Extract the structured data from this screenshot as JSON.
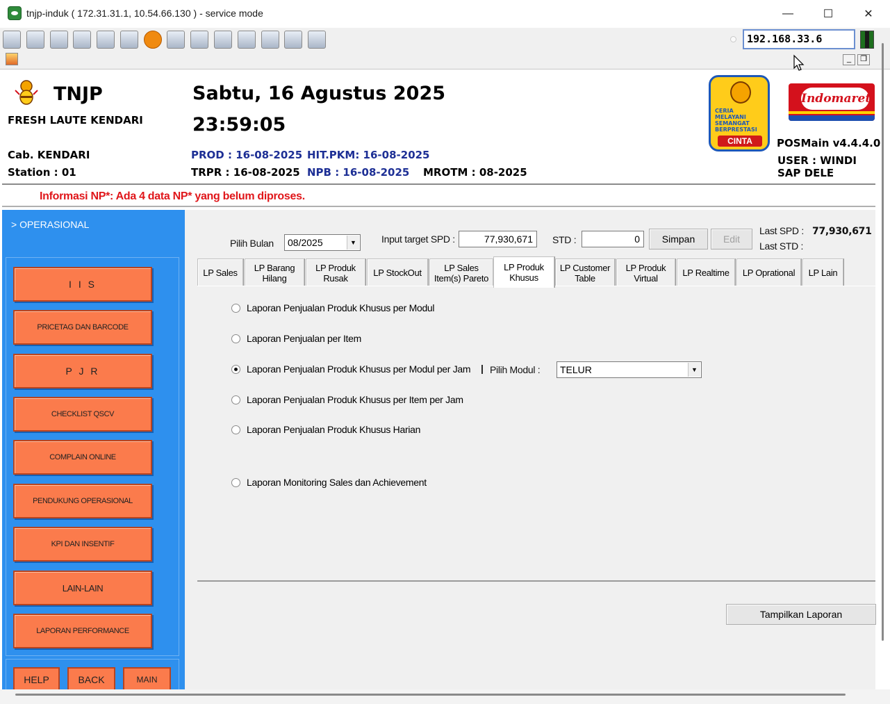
{
  "window": {
    "title": "tnjp-induk ( 172.31.31.1, 10.54.66.130 ) - service mode",
    "minimize": "—",
    "maximize": "☐",
    "close": "✕"
  },
  "toolbar": {
    "icons": [
      "monitor-icon",
      "windows-icon",
      "tools-icon",
      "refresh-icon",
      "windows-flag-icon",
      "keyboard-icon",
      "alert-icon",
      "network-icon",
      "fullscreen-icon",
      "display-icon",
      "transfer-icon",
      "notes-icon",
      "map-icon",
      "chat-icon"
    ],
    "ip_address": "192.168.33.6",
    "mdi_minimize": "_",
    "mdi_restore": "❐"
  },
  "header": {
    "brand": "TNJP",
    "store_name": "FRESH LAUTE KENDARI",
    "date": "Sabtu, 16 Agustus 2025",
    "time": "23:59:05",
    "branch": "Cab. KENDARI",
    "station": "Station : 01",
    "prod": "PROD : 16-08-2025",
    "hit_pkm": "HIT.PKM: 16-08-2025",
    "trpr": "TRPR : 16-08-2025",
    "npb": "NPB : 16-08-2025",
    "mrotm": "MROTM : 08-2025",
    "cinta_motto": "CERIA MELAYANI SEMANGAT BERPRESTASI",
    "cinta_label": "CINTA",
    "indomaret_logo": "Indomaret",
    "version": "POSMain v4.4.4.0",
    "user": "USER : WINDI SAP DELE"
  },
  "info": {
    "message": "Informasi NP*: Ada 4 data NP* yang belum diproses."
  },
  "sidebar": {
    "title": "> OPERASIONAL",
    "items": [
      {
        "label": "I I S"
      },
      {
        "label": "PRICETAG DAN BARCODE"
      },
      {
        "label": "P J R"
      },
      {
        "label": "CHECKLIST QSCV"
      },
      {
        "label": "COMPLAIN ONLINE"
      },
      {
        "label": "PENDUKUNG OPERASIONAL"
      },
      {
        "label": "KPI DAN INSENTIF"
      },
      {
        "label": "LAIN-LAIN"
      },
      {
        "label": "LAPORAN PERFORMANCE"
      }
    ],
    "bottom": {
      "help": "HELP",
      "back": "BACK",
      "main": "MAIN"
    }
  },
  "form": {
    "month_label": "Pilih Bulan",
    "month_value": "08/2025",
    "target_label": "Input target SPD :",
    "target_value": "77,930,671",
    "std_label": "STD :",
    "std_value": "0",
    "save": "Simpan",
    "edit": "Edit",
    "last_spd_label": "Last SPD :",
    "last_spd_value": "77,930,671",
    "last_std_label": "Last STD :"
  },
  "tabs": [
    {
      "label": "LP Sales"
    },
    {
      "label": "LP Barang Hilang"
    },
    {
      "label": "LP Produk Rusak"
    },
    {
      "label": "LP StockOut"
    },
    {
      "label": "LP Sales Item(s) Pareto"
    },
    {
      "label": "LP Produk Khusus",
      "active": true
    },
    {
      "label": "LP Customer Table"
    },
    {
      "label": "LP Produk Virtual"
    },
    {
      "label": "LP Realtime"
    },
    {
      "label": "LP Oprational"
    },
    {
      "label": "LP Lain"
    }
  ],
  "reports": [
    {
      "label": "Laporan Penjualan Produk Khusus per Modul",
      "checked": false
    },
    {
      "label": "Laporan Penjualan per Item",
      "checked": false
    },
    {
      "label": "Laporan Penjualan Produk Khusus per Modul per Jam",
      "checked": true
    },
    {
      "label": "Laporan Penjualan Produk Khusus per Item per Jam",
      "checked": false
    },
    {
      "label": "Laporan Penjualan Produk Khusus Harian",
      "checked": false
    },
    {
      "label": "Laporan Monitoring Sales dan Achievement",
      "checked": false
    }
  ],
  "modul": {
    "separator": "|",
    "label": "Pilih Modul :",
    "value": "TELUR"
  },
  "actions": {
    "show_report": "Tampilkan Laporan"
  },
  "colors": {
    "sidebar": "#2e90ee",
    "menu_button": "#fb7b4c",
    "info_text": "#e0161a",
    "header_blue": "#1d2f95"
  }
}
